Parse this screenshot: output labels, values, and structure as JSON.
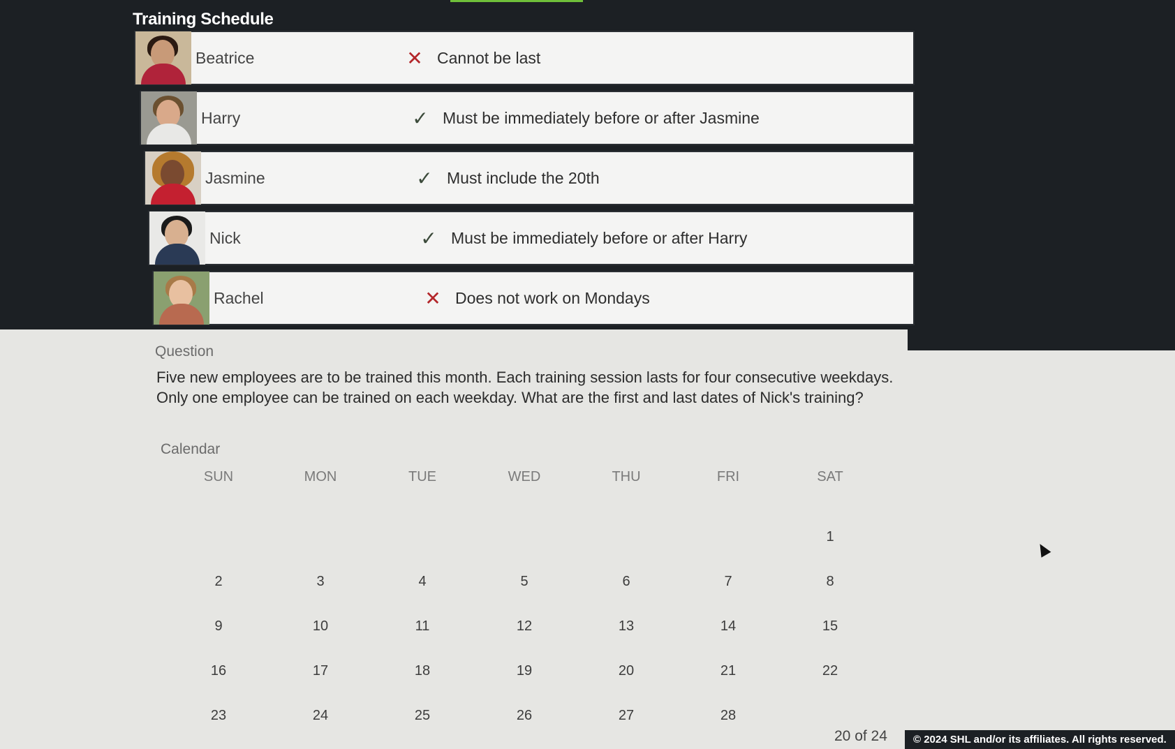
{
  "schedule": {
    "title": "Training Schedule",
    "employees": [
      {
        "name": "Beatrice",
        "status": "cross",
        "mark": "✕",
        "constraint": "Cannot be last"
      },
      {
        "name": "Harry",
        "status": "check",
        "mark": "✓",
        "constraint": "Must be immediately before or after Jasmine"
      },
      {
        "name": "Jasmine",
        "status": "check",
        "mark": "✓",
        "constraint": "Must include the 20th"
      },
      {
        "name": "Nick",
        "status": "check",
        "mark": "✓",
        "constraint": "Must be immediately before or after Harry"
      },
      {
        "name": "Rachel",
        "status": "cross",
        "mark": "✕",
        "constraint": "Does not work on Mondays"
      }
    ]
  },
  "question": {
    "label": "Question",
    "text": "Five new employees are to be trained this month. Each training session lasts for four consecutive weekdays. Only one employee can be trained on each weekday. What are the first and last dates of Nick's training?"
  },
  "calendar": {
    "label": "Calendar",
    "days": [
      "SUN",
      "MON",
      "TUE",
      "WED",
      "THU",
      "FRI",
      "SAT"
    ],
    "weeks": [
      [
        "",
        "",
        "",
        "",
        "",
        "",
        "1"
      ],
      [
        "2",
        "3",
        "4",
        "5",
        "6",
        "7",
        "8"
      ],
      [
        "9",
        "10",
        "11",
        "12",
        "13",
        "14",
        "15"
      ],
      [
        "16",
        "17",
        "18",
        "19",
        "20",
        "21",
        "22"
      ],
      [
        "23",
        "24",
        "25",
        "26",
        "27",
        "28",
        ""
      ]
    ]
  },
  "footer": {
    "page_indicator": "20 of 24",
    "copyright": "© 2024 SHL and/or its affiliates. All rights reserved."
  },
  "colors": {
    "cross": "#b3262a",
    "check": "#3b4a3a",
    "accent": "#6fbf3a"
  },
  "icons": {
    "cross": "close-icon",
    "check": "check-icon"
  }
}
